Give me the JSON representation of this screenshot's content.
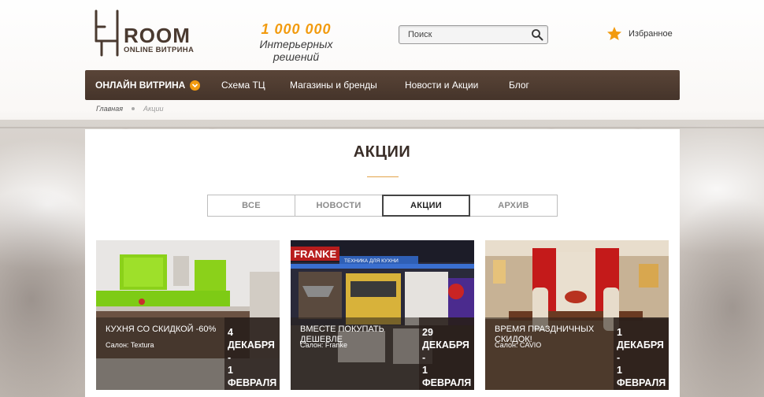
{
  "header": {
    "logo_title": "ROOM",
    "logo_subtitle": "ONLINE ВИТРИНА",
    "slogan_number": "1 000 000",
    "slogan_text": "Интерьерных решений",
    "search": {
      "placeholder": "Поиск",
      "value": ""
    },
    "favorites_label": "Избранное"
  },
  "nav": {
    "items": [
      {
        "label": "ОНЛАЙН ВИТРИНА"
      },
      {
        "label": "Схема ТЦ"
      },
      {
        "label": "Магазины и бренды"
      },
      {
        "label": "Новости и Акции"
      },
      {
        "label": "Блог"
      }
    ]
  },
  "breadcrumb": {
    "home": "Главная",
    "current": "Акции"
  },
  "page": {
    "title": "АКЦИИ",
    "tabs": [
      {
        "label": "ВСЕ",
        "active": false
      },
      {
        "label": "НОВОСТИ",
        "active": false
      },
      {
        "label": "АКЦИИ",
        "active": true
      },
      {
        "label": "АРХИВ",
        "active": false
      }
    ]
  },
  "cards": [
    {
      "title": "КУХНЯ СО СКИДКОЙ -60%",
      "salon": "Салон: Textura",
      "date_from_day": "4",
      "date_from_month": "ДЕКАБРЯ",
      "date_sep": "-",
      "date_to_day": "1",
      "date_to_month": "ФЕВРАЛЯ"
    },
    {
      "title": "ВМЕСТЕ ПОКУПАТЬ ДЕШЕВЛЕ",
      "salon": "Салон: Franke",
      "image_text_brand": "FRANKE",
      "image_text_banner": "ТЕХНИКА ДЛЯ КУХНИ",
      "date_from_day": "29",
      "date_from_month": "ДЕКАБРЯ",
      "date_sep": "-",
      "date_to_day": "1",
      "date_to_month": "ФЕВРАЛЯ"
    },
    {
      "title": "ВРЕМЯ ПРАЗДНИЧНЫХ СКИДОК!",
      "salon": "Салон: CAVIO",
      "date_from_day": "1",
      "date_from_month": "ДЕКАБРЯ",
      "date_sep": "-",
      "date_to_day": "1",
      "date_to_month": "ФЕВРАЛЯ"
    }
  ],
  "colors": {
    "accent": "#f29b0f",
    "nav_bg": "#4e3b30",
    "title_text": "#3a2e28"
  }
}
